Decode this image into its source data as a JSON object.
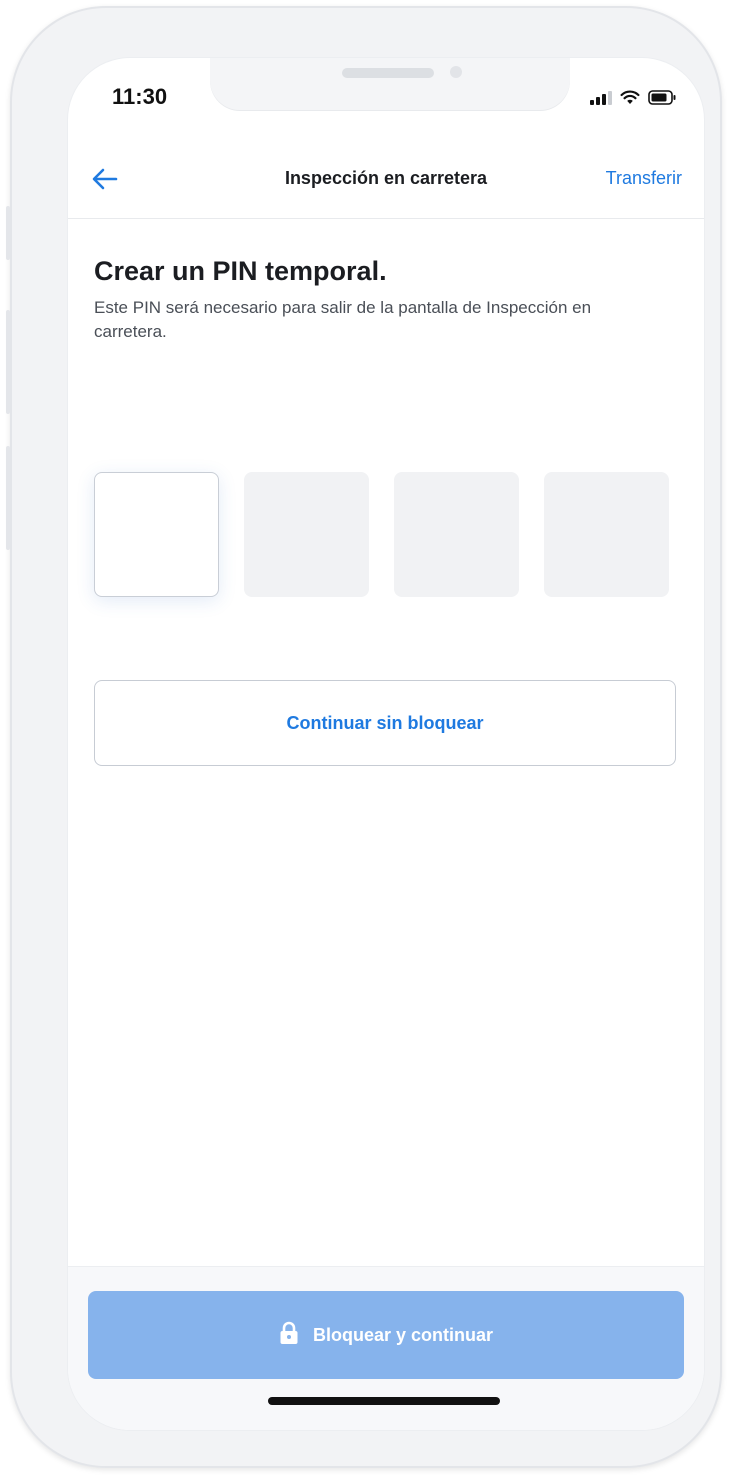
{
  "status_bar": {
    "time": "11:30",
    "icons": [
      "cellular-signal-icon",
      "wifi-icon",
      "battery-icon"
    ]
  },
  "nav": {
    "back_icon": "arrow-left-icon",
    "title": "Inspección en carretera",
    "action_label": "Transferir"
  },
  "content": {
    "heading": "Crear un PIN temporal.",
    "subtitle": "Este PIN será necesario para salir de la pantalla de Inspección en carretera.",
    "pin": {
      "length": 4,
      "filled": 0,
      "active_index": 0
    },
    "secondary_button_label": "Continuar sin bloquear"
  },
  "footer": {
    "primary_button_label": "Bloquear y continuar",
    "primary_button_icon": "lock-icon",
    "primary_button_enabled": false
  },
  "colors": {
    "accent": "#1f7ae0",
    "primary_button_disabled": "#86b3ec",
    "pin_box_inactive": "#f1f2f4"
  }
}
